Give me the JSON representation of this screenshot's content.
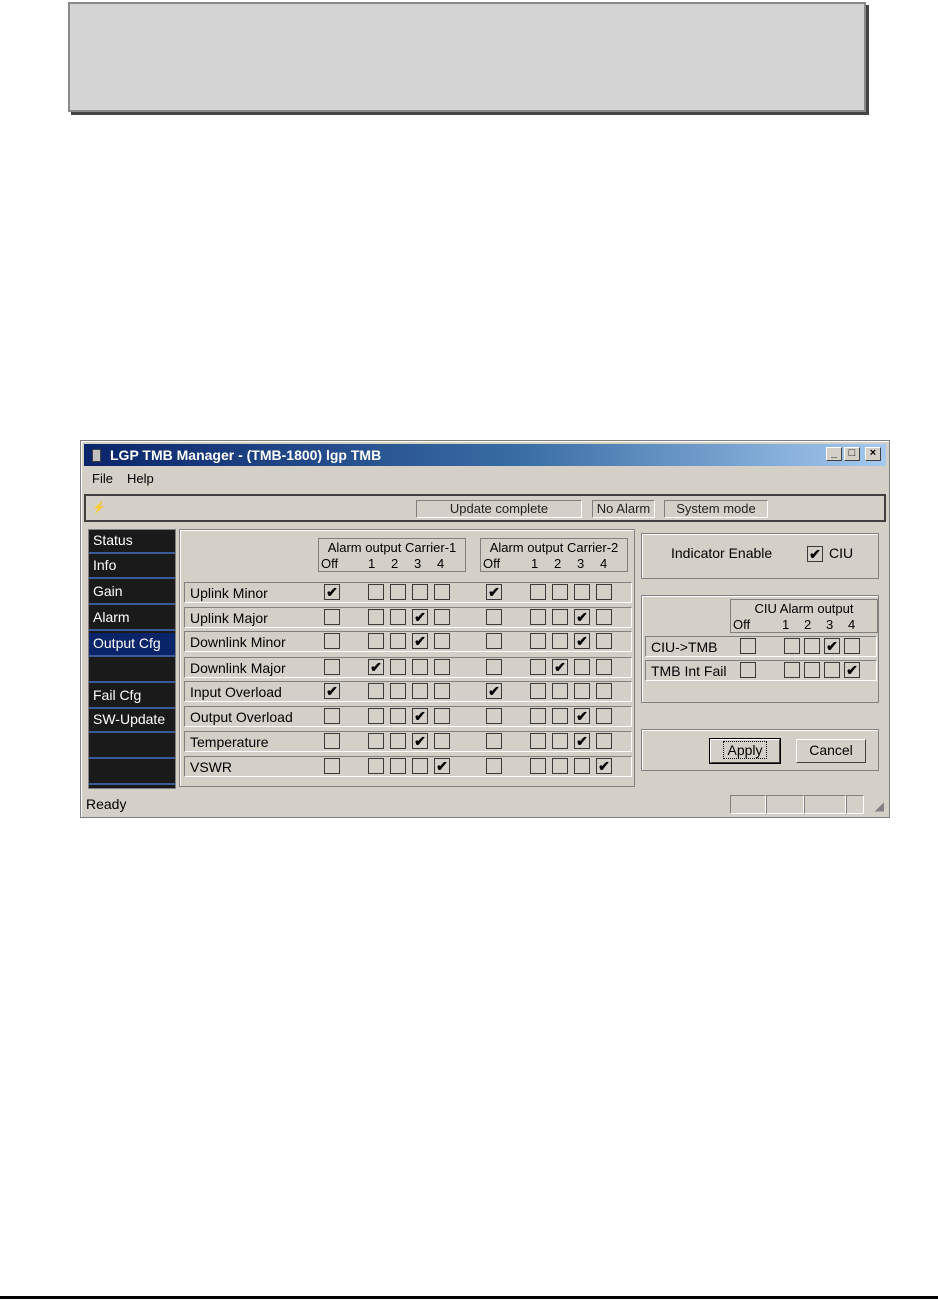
{
  "window": {
    "title": "LGP TMB Manager -  (TMB-1800) lgp TMB",
    "controls": {
      "minimize": "_",
      "maximize": "□",
      "close": "×"
    }
  },
  "menu": [
    "File",
    "Help"
  ],
  "toolbar": {
    "status_panes": [
      "Update complete",
      "No Alarm",
      "System mode"
    ]
  },
  "sidebar": {
    "items": [
      "Status",
      "Info",
      "Gain",
      "Alarm",
      "Output Cfg",
      "",
      "Fail Cfg",
      "SW-Update",
      "",
      ""
    ],
    "active_index": 4
  },
  "output_cfg": {
    "carrier1_title": "Alarm output Carrier-1",
    "carrier2_title": "Alarm output Carrier-2",
    "col_labels": [
      "Off",
      "1",
      "2",
      "3",
      "4"
    ],
    "rows": [
      {
        "label": "Uplink Minor",
        "c1": [
          1,
          0,
          0,
          0,
          0
        ],
        "c2": [
          1,
          0,
          0,
          0,
          0
        ]
      },
      {
        "label": "Uplink Major",
        "c1": [
          0,
          0,
          0,
          1,
          0
        ],
        "c2": [
          0,
          0,
          0,
          1,
          0
        ]
      },
      {
        "label": "Downlink Minor",
        "c1": [
          0,
          0,
          0,
          1,
          0
        ],
        "c2": [
          0,
          0,
          0,
          1,
          0
        ]
      },
      {
        "label": "Downlink Major",
        "c1": [
          0,
          1,
          0,
          0,
          0
        ],
        "c2": [
          0,
          0,
          1,
          0,
          0
        ]
      },
      {
        "label": "Input Overload",
        "c1": [
          1,
          0,
          0,
          0,
          0
        ],
        "c2": [
          1,
          0,
          0,
          0,
          0
        ]
      },
      {
        "label": "Output Overload",
        "c1": [
          0,
          0,
          0,
          1,
          0
        ],
        "c2": [
          0,
          0,
          0,
          1,
          0
        ]
      },
      {
        "label": "Temperature",
        "c1": [
          0,
          0,
          0,
          1,
          0
        ],
        "c2": [
          0,
          0,
          0,
          1,
          0
        ]
      },
      {
        "label": "VSWR",
        "c1": [
          0,
          0,
          0,
          0,
          1
        ],
        "c2": [
          0,
          0,
          0,
          0,
          1
        ]
      }
    ]
  },
  "indicator": {
    "label": "Indicator Enable",
    "ciu_label": "CIU",
    "ciu_checked": true
  },
  "ciu_alarm": {
    "title": "CIU Alarm output",
    "col_labels": [
      "Off",
      "1",
      "2",
      "3",
      "4"
    ],
    "rows": [
      {
        "label": "CIU->TMB",
        "values": [
          0,
          0,
          0,
          1,
          0
        ]
      },
      {
        "label": "TMB Int Fail",
        "values": [
          0,
          0,
          0,
          0,
          1
        ]
      }
    ]
  },
  "buttons": {
    "apply": "Apply",
    "cancel": "Cancel"
  },
  "statusbar": {
    "text": "Ready"
  },
  "check_glyph": "✔"
}
